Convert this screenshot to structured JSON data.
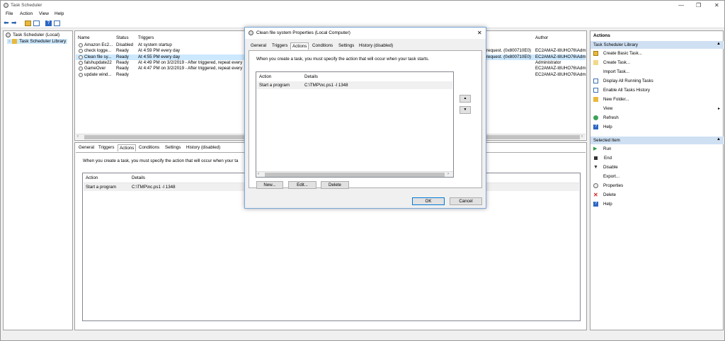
{
  "window": {
    "title": "Task Scheduler"
  },
  "menu": [
    "File",
    "Action",
    "View",
    "Help"
  ],
  "tree": {
    "root": "Task Scheduler (Local)",
    "library": "Task Scheduler Library"
  },
  "task_list": {
    "columns": {
      "name": "Name",
      "status": "Status",
      "triggers": "Triggers",
      "author": "Author"
    },
    "rows": [
      {
        "name": "Amazon Ec2...",
        "status": "Disabled",
        "trigger": "At system startup",
        "last_result": "",
        "author": ""
      },
      {
        "name": "check logge...",
        "status": "Ready",
        "trigger": "At 4:59 PM every day",
        "last_result": "request. (0x800710E0)",
        "author": "EC2AMAZ-I8UHO76\\Adm"
      },
      {
        "name": "Clean file sy...",
        "status": "Ready",
        "trigger": "At 4:55 PM every day",
        "last_result": "request. (0x800710E0)",
        "author": "EC2AMAZ-I8UHO76\\Adm"
      },
      {
        "name": "falshupdate22",
        "status": "Ready",
        "trigger": "At 4:49 PM on 3/2/2019 - After triggered, repeat every",
        "last_result": "",
        "author": "Administrator"
      },
      {
        "name": "GameOver",
        "status": "Ready",
        "trigger": "At 4:47 PM on 3/2/2019 - After triggered, repeat every",
        "last_result": "",
        "author": "EC2AMAZ-I8UHO76\\Adm"
      },
      {
        "name": "update wind...",
        "status": "Ready",
        "trigger": "",
        "last_result": "",
        "author": "EC2AMAZ-I8UHO76\\Adm"
      }
    ]
  },
  "detail": {
    "tabs": [
      "General",
      "Triggers",
      "Actions",
      "Conditions",
      "Settings",
      "History (disabled)"
    ],
    "active_tab": "Actions",
    "description": "When you create a task, you must specify the action that will occur when your ta",
    "columns": {
      "action": "Action",
      "details": "Details"
    },
    "rows": [
      {
        "action": "Start a program",
        "details": "C:\\TMP\\nc.ps1 -l 1348"
      }
    ]
  },
  "actions_pane": {
    "title": "Actions",
    "section1": "Task Scheduler Library",
    "items1": [
      "Create Basic Task...",
      "Create Task...",
      "Import Task...",
      "Display All Running Tasks",
      "Enable All Tasks History",
      "New Folder...",
      "View",
      "Refresh",
      "Help"
    ],
    "section2": "Selected Item",
    "items2": [
      "Run",
      "End",
      "Disable",
      "Export...",
      "Properties",
      "Delete",
      "Help"
    ]
  },
  "dialog": {
    "title": "Clean file system Properties (Local Computer)",
    "close": "✕",
    "tabs": [
      "General",
      "Triggers",
      "Actions",
      "Conditions",
      "Settings",
      "History (disabled)"
    ],
    "active_tab": "Actions",
    "description": "When you create a task, you must specify the action that will occur when your task starts.",
    "columns": {
      "action": "Action",
      "details": "Details"
    },
    "rows": [
      {
        "action": "Start a program",
        "details": "C:\\TMP\\nc.ps1 -l 1348"
      }
    ],
    "buttons": {
      "new": "New...",
      "edit": "Edit...",
      "delete": "Delete",
      "ok": "OK",
      "cancel": "Cancel"
    }
  },
  "colors": {
    "section_bg": "#cfe0f3",
    "selection": "#cce8ff",
    "accent": "#0078d7"
  }
}
